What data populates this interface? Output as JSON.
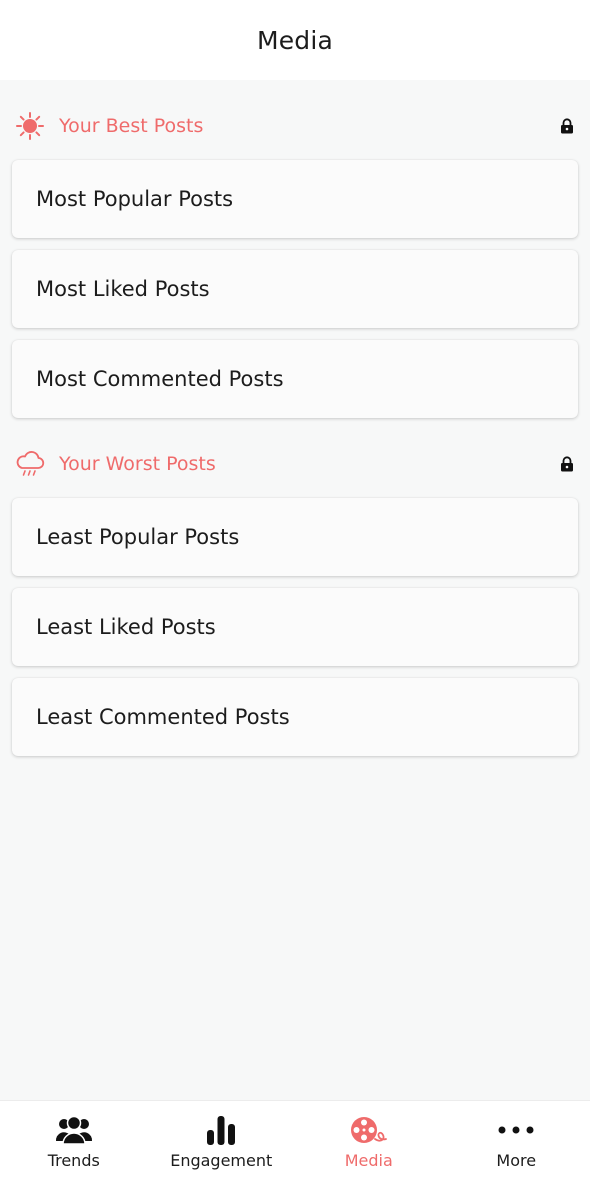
{
  "header": {
    "title": "Media"
  },
  "sections": [
    {
      "label": "Your Best Posts",
      "icon": "sun-icon",
      "items": [
        {
          "label": "Most Popular Posts"
        },
        {
          "label": "Most Liked Posts"
        },
        {
          "label": "Most Commented Posts"
        }
      ]
    },
    {
      "label": "Your Worst Posts",
      "icon": "rain-cloud-icon",
      "items": [
        {
          "label": "Least Popular Posts"
        },
        {
          "label": "Least Liked Posts"
        },
        {
          "label": "Least Commented Posts"
        }
      ]
    }
  ],
  "tabs": [
    {
      "label": "Trends",
      "icon": "users-icon"
    },
    {
      "label": "Engagement",
      "icon": "bar-chart-icon"
    },
    {
      "label": "Media",
      "icon": "film-reel-icon",
      "active": true
    },
    {
      "label": "More",
      "icon": "more-dots-icon"
    }
  ],
  "colors": {
    "accent": "#ef6b6b",
    "text": "#1c1c1c",
    "background": "#f7f8f8"
  }
}
